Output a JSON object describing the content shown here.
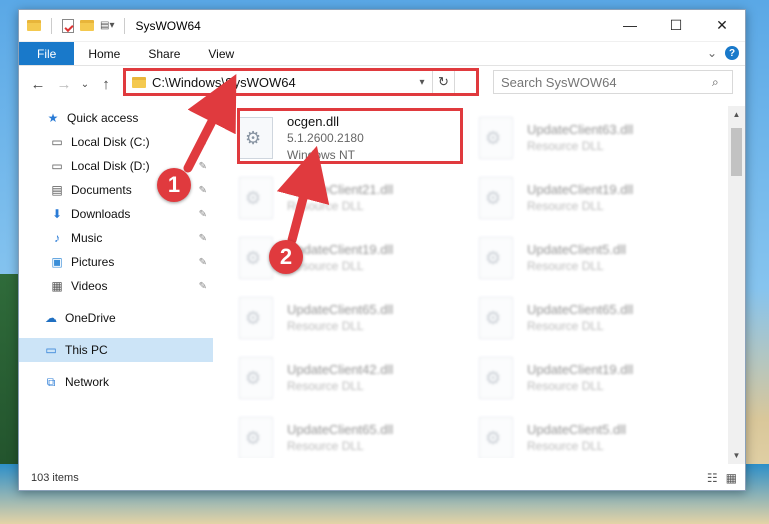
{
  "window": {
    "title": "SysWOW64"
  },
  "caption": {
    "minimize": "—",
    "maximize": "☐",
    "close": "✕"
  },
  "ribbon": {
    "tabs": [
      "File",
      "Home",
      "Share",
      "View"
    ],
    "expand": "⌄",
    "help": "?"
  },
  "address": {
    "path": "C:\\Windows\\SysWOW64",
    "dropdown": "▾",
    "refresh": "↻"
  },
  "search": {
    "placeholder": "Search SysWOW64",
    "icon": "search-icon"
  },
  "nav": {
    "back": "←",
    "forward": "→",
    "recent": "⌄",
    "up": "↑"
  },
  "sidebar": {
    "items": [
      {
        "label": "Quick access",
        "icon": "star-icon",
        "pinned": false
      },
      {
        "label": "Local Disk (C:)",
        "icon": "drive-icon",
        "pinned": true
      },
      {
        "label": "Local Disk (D:)",
        "icon": "drive-icon",
        "pinned": true
      },
      {
        "label": "Documents",
        "icon": "documents-icon",
        "pinned": true
      },
      {
        "label": "Downloads",
        "icon": "download-icon",
        "pinned": true
      },
      {
        "label": "Music",
        "icon": "music-icon",
        "pinned": true
      },
      {
        "label": "Pictures",
        "icon": "pictures-icon",
        "pinned": true
      },
      {
        "label": "Videos",
        "icon": "videos-icon",
        "pinned": true
      },
      {
        "label": "OneDrive",
        "icon": "cloud-icon",
        "pinned": false
      },
      {
        "label": "This PC",
        "icon": "pc-icon",
        "pinned": false,
        "selected": true
      },
      {
        "label": "Network",
        "icon": "network-icon",
        "pinned": false
      }
    ]
  },
  "files": [
    {
      "name": "ocgen.dll",
      "line2": "5.1.2600.2180",
      "line3": "Windows NT",
      "highlighted": true
    },
    {
      "name": "UpdateClient63.dll",
      "line2": "Resource DLL"
    },
    {
      "name": "UpdateClient21.dll",
      "line2": "Resource DLL"
    },
    {
      "name": "UpdateClient19.dll",
      "line2": "Resource DLL"
    },
    {
      "name": "UpdateClient19.dll",
      "line2": "Resource DLL"
    },
    {
      "name": "UpdateClient5.dll",
      "line2": "Resource DLL"
    },
    {
      "name": "UpdateClient65.dll",
      "line2": "Resource DLL"
    },
    {
      "name": "UpdateClient65.dll",
      "line2": "Resource DLL"
    },
    {
      "name": "UpdateClient42.dll",
      "line2": "Resource DLL"
    },
    {
      "name": "UpdateClient19.dll",
      "line2": "Resource DLL"
    },
    {
      "name": "UpdateClient65.dll",
      "line2": "Resource DLL"
    },
    {
      "name": "UpdateClient5.dll",
      "line2": "Resource DLL"
    }
  ],
  "status": {
    "count": "103 items"
  },
  "annotations": {
    "step1": "1",
    "step2": "2",
    "color": "#e03a3e"
  }
}
